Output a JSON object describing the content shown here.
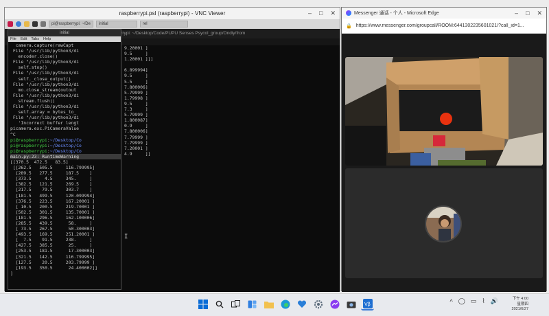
{
  "vnc": {
    "title": "raspberrypi.psl (raspberrypi) - VNC Viewer",
    "panel_tasks": [
      "pi@raspberrypi: ~/De",
      "initial",
      "rel"
    ],
    "back_terminal_title": "pi@raspberrypi: ~/Desktop/Code/PUPU Senses Psycol_group/Ondiy/from",
    "main_terminal_title": "initial",
    "main_terminal_menu": [
      "File",
      "Edit",
      "Tabs",
      "Help"
    ],
    "main_lines": [
      "  camera.capture(rawCapt",
      " File \"/usr/lib/python3/di",
      "   encoder.close()",
      " File \"/usr/lib/python3/di",
      "   self.stop()",
      " File \"/usr/lib/python3/di",
      "   self._close_output()",
      " File \"/usr/lib/python3/di",
      "   mo.close_stream(outout",
      " File \"/usr/lib/python3/di",
      "   stream.flush()",
      " File \"/usr/lib/python3/di",
      "   self.array = bytes_to_",
      " File \"/usr/lib/python3/di",
      "   'Incorrect buffer lengt",
      "picamera.exc.PiCameraValue",
      "^C",
      "pi@raspberrypi:~/Desktop/Co",
      "pi@raspberrypi:~/Desktop/Co",
      "pi@raspberrypi:~/Desktop/Co",
      "main.py:23: RuntimeWarning",
      "[[370.5  472.5   83.5]",
      " [[262.5   505.5     116.799995]",
      "  [289.5   277.5     187.5    ]",
      "  [373.5     4.5     345.     ]",
      "  [382.5   121.5     269.5    ]",
      "  [217.5    79.5     303.7    ]",
      "  [181.5   499.5     120.099994]",
      "  [376.5   223.5     167.20001 ]",
      "  [ 10.5   200.5     219.70001 ]",
      "  [502.5   301.5     135.70001 ]",
      "  [181.5   296.5     162.100006]",
      "  [285.5   439.5      58.     ]",
      "  [ 73.5   267.5      50.300003]",
      "  [493.5   169.5     251.20001 ]",
      "  [  7.5    91.5     238.     ]",
      "  [427.5   385.5      25.     ]",
      "  [253.5   181.5      17.300003]",
      "  [321.5   142.5     116.799995]",
      "  [127.5    20.5     203.79999 ]",
      "  [193.5   350.5      24.400002]]",
      "]"
    ],
    "right_lines": [
      "9.20001 ]",
      "9.5     ]",
      "1.20001 ]]]",
      "",
      "6.899994]",
      "9.5     ]",
      "5.5     ]",
      "7.800006]",
      "5.79999 ]",
      "1.79998 ]",
      "9.5     ]",
      "7.3     ]",
      "5.79999 ]",
      "1.800087]",
      "0.9     ]",
      "7.800006]",
      "7.79999 ]",
      "7.79999 ]",
      "7.20001 ]",
      "4.9     ]]"
    ],
    "cursor_glyph": "I"
  },
  "messenger": {
    "title": "Messenger 通话 - 个人 - Microsoft Edge",
    "url": "https://www.messenger.com/groupcall/ROOM:6441302235601021/?call_id=1...",
    "chevron": "‹"
  },
  "taskbar": {
    "tray_glyphs": [
      "^",
      "◯",
      "▭",
      "⌇",
      "🔊"
    ],
    "clock_time": "下午 4:00",
    "clock_label": "星期四",
    "clock_date": "2021/6/27"
  },
  "colors": {
    "terminal_bg": "#0c0c0c",
    "prompt_green": "#43d043",
    "path_blue": "#6a8cff",
    "taskbar_bg": "#e8eaee",
    "ball_red": "#e8320f"
  }
}
